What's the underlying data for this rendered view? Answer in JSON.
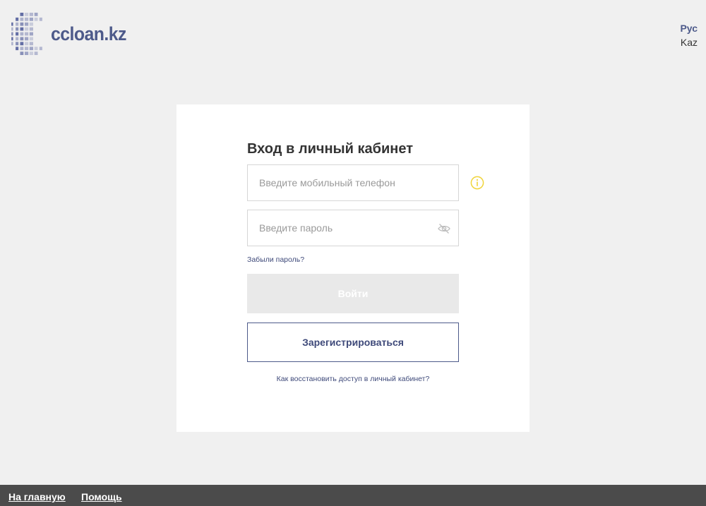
{
  "header": {
    "logo_text": "ccloan.kz",
    "languages": [
      {
        "label": "Рус",
        "active": true
      },
      {
        "label": "Kaz",
        "active": false
      }
    ]
  },
  "login": {
    "title": "Вход в личный кабинет",
    "phone_placeholder": "Введите мобильный телефон",
    "phone_value": "",
    "password_placeholder": "Введите пароль",
    "password_value": "",
    "forgot_label": "Забыли пароль?",
    "login_label": "Войти",
    "register_label": "Зарегистрироваться",
    "restore_label": "Как восстановить доступ в личный кабинет?"
  },
  "footer": {
    "home_label": "На главную",
    "help_label": "Помощь"
  },
  "colors": {
    "brand": "#4d5a8a",
    "info_icon": "#f0d43a",
    "page_bg": "#f0f0f0",
    "footer_bg": "#4b4b4b",
    "disabled_button": "#e9e9e9"
  },
  "icons": {
    "info": "info-circle-icon",
    "password_toggle": "eye-off-icon",
    "logo": "globe-grid-icon"
  }
}
